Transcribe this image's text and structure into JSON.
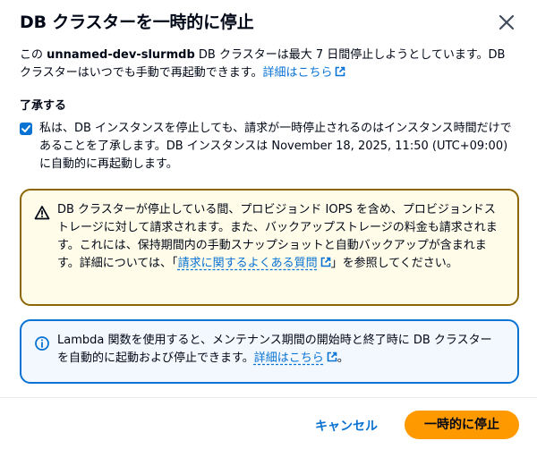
{
  "modal": {
    "title": "DB クラスターを一時的に停止"
  },
  "intro": {
    "prefix": "この ",
    "cluster_name": "unnamed-dev-slurmdb",
    "suffix": " DB クラスターは最大 7 日間停止しようとしています。DB クラスターはいつでも手動で再起動できます。",
    "link_label": "詳細はこちら"
  },
  "acknowledge": {
    "title": "了承する",
    "checked": true,
    "text": "私は、DB インスタンスを停止しても、請求が一時停止されるのはインスタンス時間だけであることを了承します。DB インスタンスは November 18, 2025, 11:50 (UTC+09:00) に自動的に再起動します。"
  },
  "warning_alert": {
    "text_before": "DB クラスターが停止している間、プロビジョンド IOPS を含め、プロビジョンドストレージに対して請求されます。また、バックアップストレージの料金も請求されます。これには、保持期間内の手動スナップショットと自動バックアップが含まれます。詳細については、「",
    "link_label": "請求に関するよくある質問",
    "text_after": "」を参照してください。",
    "color": "#8d6605"
  },
  "info_alert": {
    "text_before": "Lambda 関数を使用すると、メンテナンス期間の開始時と終了時に DB クラスターを自動的に起動および停止できます。",
    "link_label": "詳細はこちら",
    "text_after": "。",
    "color": "#0972d3"
  },
  "footer": {
    "cancel_label": "キャンセル",
    "confirm_label": "一時的に停止",
    "confirm_color": "#ff9900"
  }
}
